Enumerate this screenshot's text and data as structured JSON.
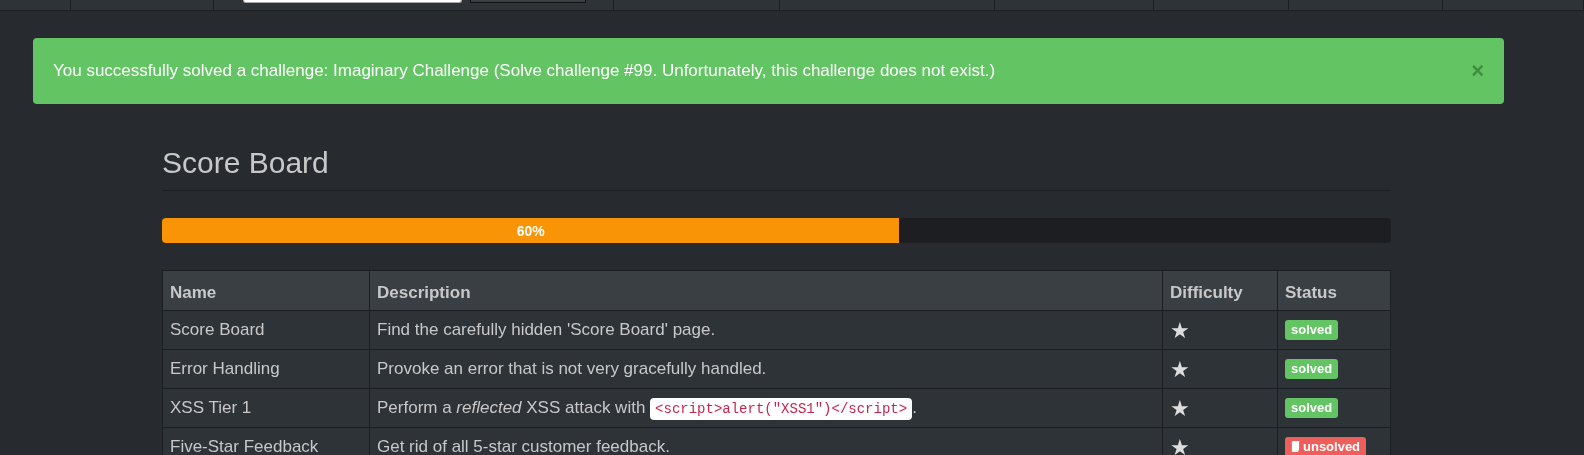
{
  "alert": {
    "message": "You successfully solved a challenge: Imaginary Challenge (Solve challenge #99. Unfortunately, this challenge does not exist.)",
    "close": "×"
  },
  "heading": "Score Board",
  "progress": {
    "level": 0.6,
    "label": "60%"
  },
  "table": {
    "columns": [
      "Name",
      "Description",
      "Difficulty",
      "Status"
    ],
    "rows": [
      {
        "name": "Score Board",
        "description": "Find the carefully hidden 'Score Board' page.",
        "difficulty": "★",
        "status": {
          "kind": "solved",
          "label": "solved"
        }
      },
      {
        "name": "Error Handling",
        "description": "Provoke an error that is not very gracefully handled.",
        "difficulty": "★",
        "status": {
          "kind": "solved",
          "label": "solved"
        }
      },
      {
        "name": "XSS Tier 1",
        "description": "Perform a *reflected* XSS attack with",
        "code": "<script>alert(\"XSS1\")</script>",
        "description_end": ".",
        "difficulty": "★",
        "status": {
          "kind": "solved",
          "label": "solved"
        }
      },
      {
        "name": "Five-Star Feedback",
        "description": "Get rid of all 5-star customer feedback.",
        "difficulty": "★",
        "status": {
          "kind": "unsolved",
          "label": "unsolved"
        }
      }
    ]
  }
}
